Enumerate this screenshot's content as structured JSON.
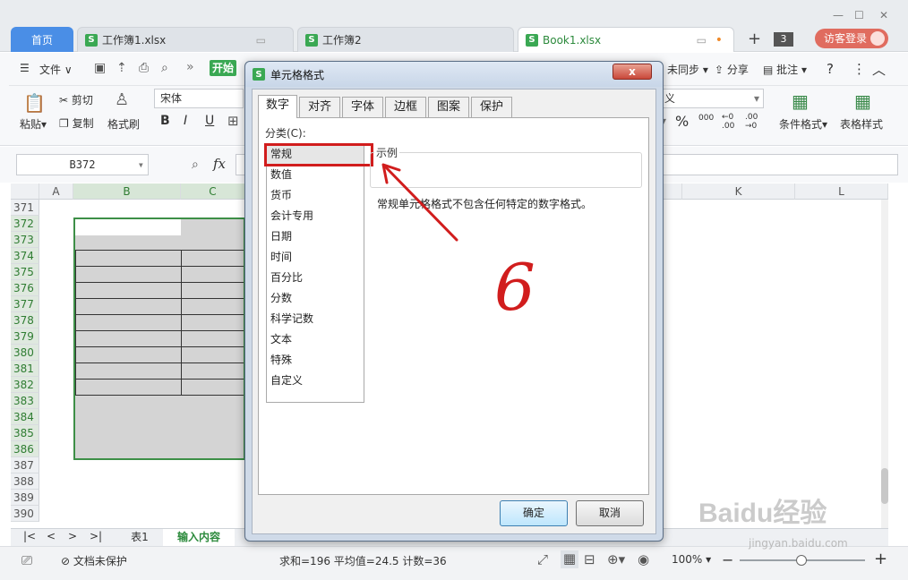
{
  "tabs": {
    "home": "首页",
    "file1": "工作簿1.xlsx",
    "file2": "工作簿2",
    "file3": "Book1.xlsx",
    "count": "3",
    "login": "访客登录"
  },
  "toolbar": {
    "file_menu": "文件",
    "start": "开始",
    "sync": "未同步",
    "share": "分享",
    "annotate": "批注",
    "help": "?",
    "paste": "粘贴",
    "cut": "剪切",
    "copy": "复制",
    "format_painter": "格式刷",
    "font_name": "宋体",
    "bold": "B",
    "italic": "I",
    "underline": "U",
    "number_format_partial": "义",
    "percent": "%",
    "cond_format": "条件格式",
    "table_style": "表格样式"
  },
  "formula": {
    "namebox": "B372",
    "fx": "fx"
  },
  "columns": [
    "A",
    "B",
    "C",
    "K",
    "L"
  ],
  "rows": [
    "371",
    "372",
    "373",
    "374",
    "375",
    "376",
    "377",
    "378",
    "379",
    "380",
    "381",
    "382",
    "383",
    "384",
    "385",
    "386",
    "387",
    "388",
    "389",
    "390"
  ],
  "sheets": {
    "sheet1": "表1",
    "sheet2": "输入内容"
  },
  "status": {
    "protect": "文档未保护",
    "summary": "求和=196  平均值=24.5  计数=36",
    "zoom": "100%"
  },
  "dialog": {
    "title": "单元格格式",
    "close": "x",
    "tabs": [
      "数字",
      "对齐",
      "字体",
      "边框",
      "图案",
      "保护"
    ],
    "category_label": "分类(C):",
    "categories": [
      "常规",
      "数值",
      "货币",
      "会计专用",
      "日期",
      "时间",
      "百分比",
      "分数",
      "科学记数",
      "文本",
      "特殊",
      "自定义"
    ],
    "sample_label": "示例",
    "description": "常规单元格格式不包含任何特定的数字格式。",
    "ok": "确定",
    "cancel": "取消"
  },
  "annotation": {
    "handwritten": "6",
    "color": "#d11d1d"
  },
  "watermark": {
    "brand": "Baidu经验",
    "url": "jingyan.baidu.com"
  }
}
